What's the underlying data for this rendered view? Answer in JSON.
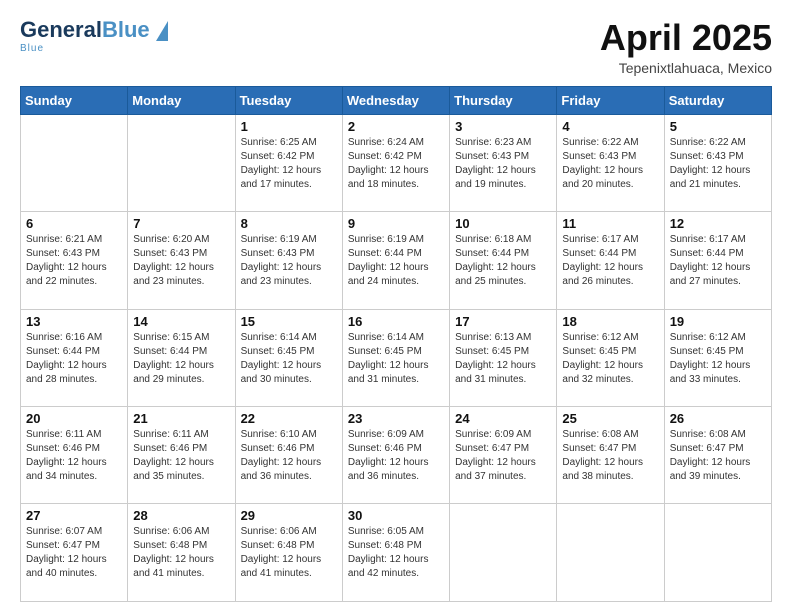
{
  "header": {
    "logo_general": "General",
    "logo_blue": "Blue",
    "title": "April 2025",
    "subtitle": "Tepenixtlahuaca, Mexico"
  },
  "days_of_week": [
    "Sunday",
    "Monday",
    "Tuesday",
    "Wednesday",
    "Thursday",
    "Friday",
    "Saturday"
  ],
  "weeks": [
    [
      {
        "day": "",
        "sunrise": "",
        "sunset": "",
        "daylight": ""
      },
      {
        "day": "",
        "sunrise": "",
        "sunset": "",
        "daylight": ""
      },
      {
        "day": "1",
        "sunrise": "Sunrise: 6:25 AM",
        "sunset": "Sunset: 6:42 PM",
        "daylight": "Daylight: 12 hours and 17 minutes."
      },
      {
        "day": "2",
        "sunrise": "Sunrise: 6:24 AM",
        "sunset": "Sunset: 6:42 PM",
        "daylight": "Daylight: 12 hours and 18 minutes."
      },
      {
        "day": "3",
        "sunrise": "Sunrise: 6:23 AM",
        "sunset": "Sunset: 6:43 PM",
        "daylight": "Daylight: 12 hours and 19 minutes."
      },
      {
        "day": "4",
        "sunrise": "Sunrise: 6:22 AM",
        "sunset": "Sunset: 6:43 PM",
        "daylight": "Daylight: 12 hours and 20 minutes."
      },
      {
        "day": "5",
        "sunrise": "Sunrise: 6:22 AM",
        "sunset": "Sunset: 6:43 PM",
        "daylight": "Daylight: 12 hours and 21 minutes."
      }
    ],
    [
      {
        "day": "6",
        "sunrise": "Sunrise: 6:21 AM",
        "sunset": "Sunset: 6:43 PM",
        "daylight": "Daylight: 12 hours and 22 minutes."
      },
      {
        "day": "7",
        "sunrise": "Sunrise: 6:20 AM",
        "sunset": "Sunset: 6:43 PM",
        "daylight": "Daylight: 12 hours and 23 minutes."
      },
      {
        "day": "8",
        "sunrise": "Sunrise: 6:19 AM",
        "sunset": "Sunset: 6:43 PM",
        "daylight": "Daylight: 12 hours and 23 minutes."
      },
      {
        "day": "9",
        "sunrise": "Sunrise: 6:19 AM",
        "sunset": "Sunset: 6:44 PM",
        "daylight": "Daylight: 12 hours and 24 minutes."
      },
      {
        "day": "10",
        "sunrise": "Sunrise: 6:18 AM",
        "sunset": "Sunset: 6:44 PM",
        "daylight": "Daylight: 12 hours and 25 minutes."
      },
      {
        "day": "11",
        "sunrise": "Sunrise: 6:17 AM",
        "sunset": "Sunset: 6:44 PM",
        "daylight": "Daylight: 12 hours and 26 minutes."
      },
      {
        "day": "12",
        "sunrise": "Sunrise: 6:17 AM",
        "sunset": "Sunset: 6:44 PM",
        "daylight": "Daylight: 12 hours and 27 minutes."
      }
    ],
    [
      {
        "day": "13",
        "sunrise": "Sunrise: 6:16 AM",
        "sunset": "Sunset: 6:44 PM",
        "daylight": "Daylight: 12 hours and 28 minutes."
      },
      {
        "day": "14",
        "sunrise": "Sunrise: 6:15 AM",
        "sunset": "Sunset: 6:44 PM",
        "daylight": "Daylight: 12 hours and 29 minutes."
      },
      {
        "day": "15",
        "sunrise": "Sunrise: 6:14 AM",
        "sunset": "Sunset: 6:45 PM",
        "daylight": "Daylight: 12 hours and 30 minutes."
      },
      {
        "day": "16",
        "sunrise": "Sunrise: 6:14 AM",
        "sunset": "Sunset: 6:45 PM",
        "daylight": "Daylight: 12 hours and 31 minutes."
      },
      {
        "day": "17",
        "sunrise": "Sunrise: 6:13 AM",
        "sunset": "Sunset: 6:45 PM",
        "daylight": "Daylight: 12 hours and 31 minutes."
      },
      {
        "day": "18",
        "sunrise": "Sunrise: 6:12 AM",
        "sunset": "Sunset: 6:45 PM",
        "daylight": "Daylight: 12 hours and 32 minutes."
      },
      {
        "day": "19",
        "sunrise": "Sunrise: 6:12 AM",
        "sunset": "Sunset: 6:45 PM",
        "daylight": "Daylight: 12 hours and 33 minutes."
      }
    ],
    [
      {
        "day": "20",
        "sunrise": "Sunrise: 6:11 AM",
        "sunset": "Sunset: 6:46 PM",
        "daylight": "Daylight: 12 hours and 34 minutes."
      },
      {
        "day": "21",
        "sunrise": "Sunrise: 6:11 AM",
        "sunset": "Sunset: 6:46 PM",
        "daylight": "Daylight: 12 hours and 35 minutes."
      },
      {
        "day": "22",
        "sunrise": "Sunrise: 6:10 AM",
        "sunset": "Sunset: 6:46 PM",
        "daylight": "Daylight: 12 hours and 36 minutes."
      },
      {
        "day": "23",
        "sunrise": "Sunrise: 6:09 AM",
        "sunset": "Sunset: 6:46 PM",
        "daylight": "Daylight: 12 hours and 36 minutes."
      },
      {
        "day": "24",
        "sunrise": "Sunrise: 6:09 AM",
        "sunset": "Sunset: 6:47 PM",
        "daylight": "Daylight: 12 hours and 37 minutes."
      },
      {
        "day": "25",
        "sunrise": "Sunrise: 6:08 AM",
        "sunset": "Sunset: 6:47 PM",
        "daylight": "Daylight: 12 hours and 38 minutes."
      },
      {
        "day": "26",
        "sunrise": "Sunrise: 6:08 AM",
        "sunset": "Sunset: 6:47 PM",
        "daylight": "Daylight: 12 hours and 39 minutes."
      }
    ],
    [
      {
        "day": "27",
        "sunrise": "Sunrise: 6:07 AM",
        "sunset": "Sunset: 6:47 PM",
        "daylight": "Daylight: 12 hours and 40 minutes."
      },
      {
        "day": "28",
        "sunrise": "Sunrise: 6:06 AM",
        "sunset": "Sunset: 6:48 PM",
        "daylight": "Daylight: 12 hours and 41 minutes."
      },
      {
        "day": "29",
        "sunrise": "Sunrise: 6:06 AM",
        "sunset": "Sunset: 6:48 PM",
        "daylight": "Daylight: 12 hours and 41 minutes."
      },
      {
        "day": "30",
        "sunrise": "Sunrise: 6:05 AM",
        "sunset": "Sunset: 6:48 PM",
        "daylight": "Daylight: 12 hours and 42 minutes."
      },
      {
        "day": "",
        "sunrise": "",
        "sunset": "",
        "daylight": ""
      },
      {
        "day": "",
        "sunrise": "",
        "sunset": "",
        "daylight": ""
      },
      {
        "day": "",
        "sunrise": "",
        "sunset": "",
        "daylight": ""
      }
    ]
  ]
}
